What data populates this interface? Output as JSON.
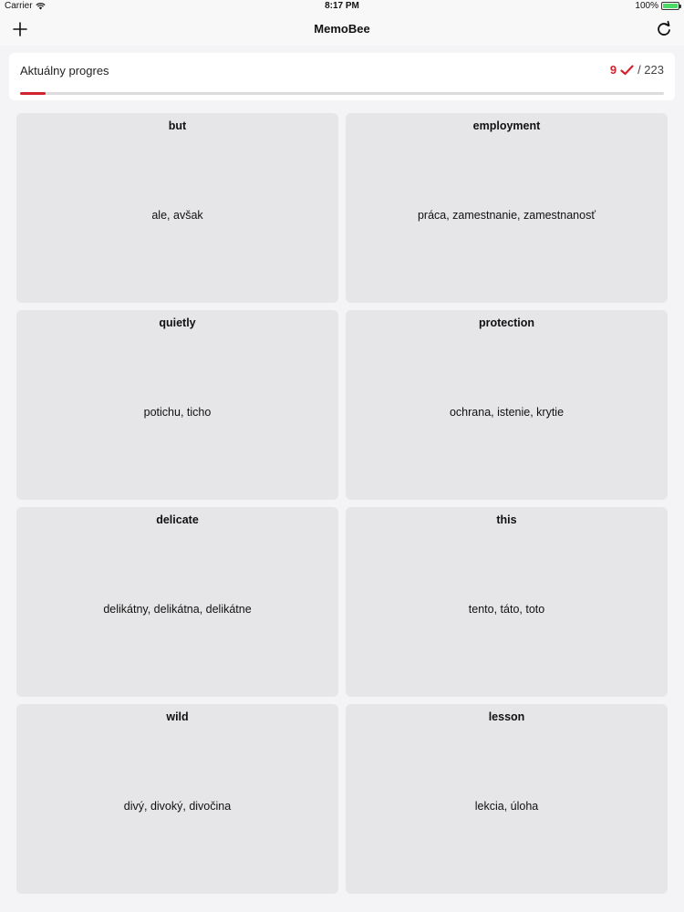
{
  "status_bar": {
    "carrier": "Carrier",
    "time": "8:17 PM",
    "battery": "100%"
  },
  "nav": {
    "title": "MemoBee",
    "add_icon": "plus-icon",
    "refresh_icon": "refresh-icon"
  },
  "progress": {
    "label": "Aktuálny progres",
    "done": "9",
    "total": "/ 223",
    "fraction": 0.04,
    "accent_color": "#d0232e"
  },
  "cards": [
    {
      "term": "but",
      "translation": "ale, avšak"
    },
    {
      "term": "employment",
      "translation": "práca, zamestnanie, zamestnanosť"
    },
    {
      "term": "quietly",
      "translation": "potichu, ticho"
    },
    {
      "term": "protection",
      "translation": "ochrana, istenie, krytie"
    },
    {
      "term": "delicate",
      "translation": "delikátny, delikátna, delikátne"
    },
    {
      "term": "this",
      "translation": "tento, táto, toto"
    },
    {
      "term": "wild",
      "translation": "divý, divoký, divočina"
    },
    {
      "term": "lesson",
      "translation": "lekcia, úloha"
    }
  ]
}
